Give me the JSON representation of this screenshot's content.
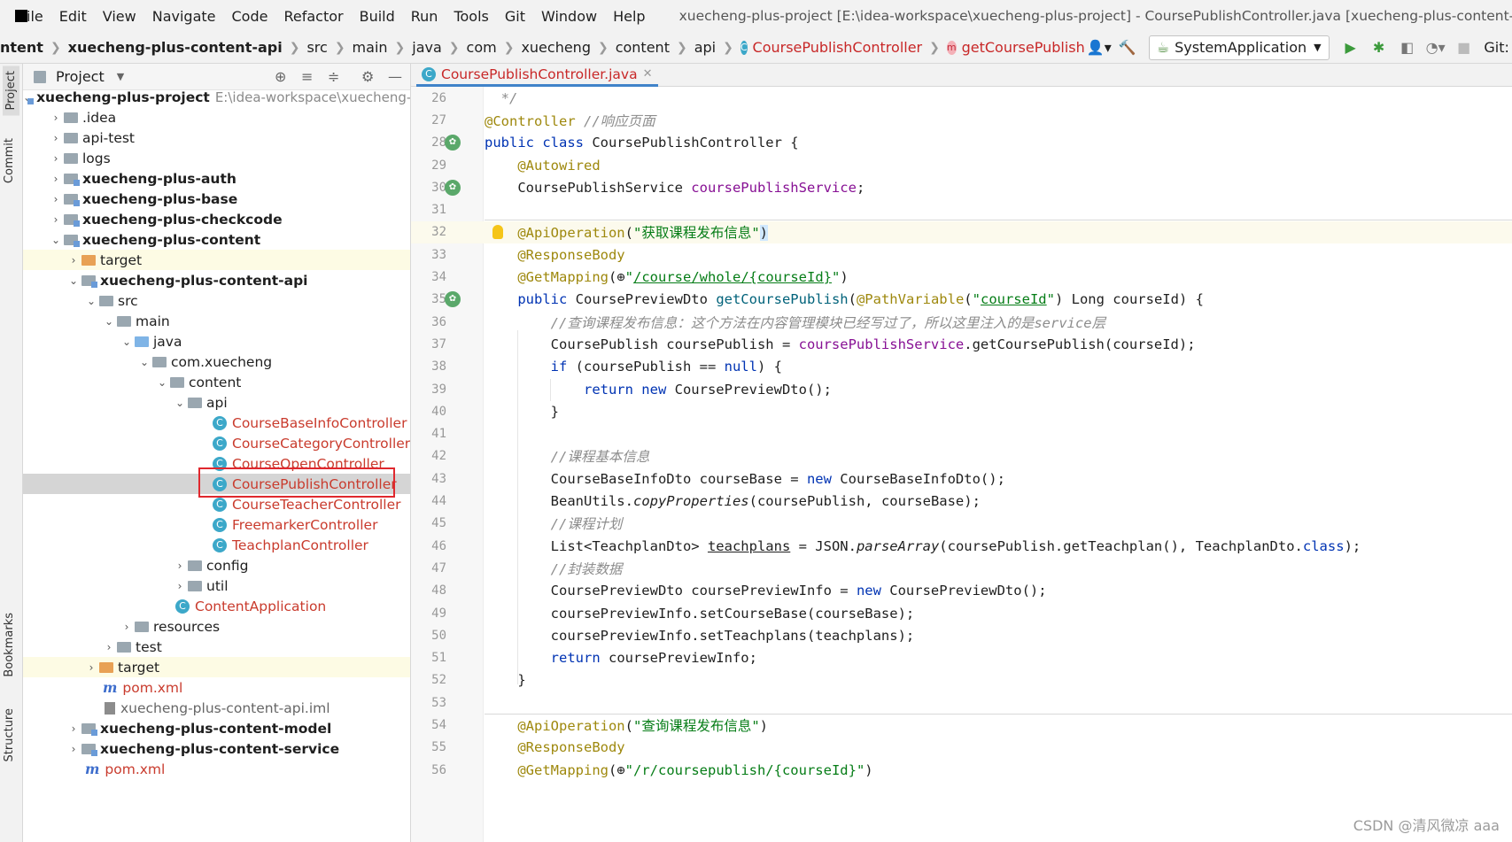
{
  "menubar": {
    "items": [
      "File",
      "Edit",
      "View",
      "Navigate",
      "Code",
      "Refactor",
      "Build",
      "Run",
      "Tools",
      "Git",
      "Window",
      "Help"
    ],
    "window_title": "xuecheng-plus-project [E:\\idea-workspace\\xuecheng-plus-project] - CoursePublishController.java [xuecheng-plus-content-api]"
  },
  "navbar": {
    "crumbs": [
      "ntent",
      "xuecheng-plus-content-api",
      "src",
      "main",
      "java",
      "com",
      "xuecheng",
      "content",
      "api"
    ],
    "class_crumb": "CoursePublishController",
    "method_crumb": "getCoursePublish",
    "run_config": "SystemApplication",
    "git_label": "Git:"
  },
  "side_tabs": {
    "project": "Project",
    "commit": "Commit",
    "bookmarks": "Bookmarks",
    "structure": "Structure"
  },
  "project_panel": {
    "title": "Project",
    "tree": [
      {
        "text": "xuecheng-plus-project",
        "path": "E:\\idea-workspace\\xuecheng-plus-project",
        "bold": true
      },
      {
        "text": ".idea"
      },
      {
        "text": "api-test"
      },
      {
        "text": "logs"
      },
      {
        "text": "xuecheng-plus-auth",
        "bold": true
      },
      {
        "text": "xuecheng-plus-base",
        "bold": true
      },
      {
        "text": "xuecheng-plus-checkcode",
        "bold": true
      },
      {
        "text": "xuecheng-plus-content",
        "bold": true
      },
      {
        "text": "target"
      },
      {
        "text": "xuecheng-plus-content-api",
        "bold": true
      },
      {
        "text": "src"
      },
      {
        "text": "main"
      },
      {
        "text": "java"
      },
      {
        "text": "com.xuecheng"
      },
      {
        "text": "content"
      },
      {
        "text": "api"
      },
      {
        "text": "CourseBaseInfoController"
      },
      {
        "text": "CourseCategoryController"
      },
      {
        "text": "CourseOpenController"
      },
      {
        "text": "CoursePublishController"
      },
      {
        "text": "CourseTeacherController"
      },
      {
        "text": "FreemarkerController"
      },
      {
        "text": "TeachplanController"
      },
      {
        "text": "config"
      },
      {
        "text": "util"
      },
      {
        "text": "ContentApplication"
      },
      {
        "text": "resources"
      },
      {
        "text": "test"
      },
      {
        "text": "target"
      },
      {
        "text": "pom.xml"
      },
      {
        "text": "xuecheng-plus-content-api.iml"
      },
      {
        "text": "xuecheng-plus-content-model",
        "bold": true
      },
      {
        "text": "xuecheng-plus-content-service",
        "bold": true
      },
      {
        "text": "pom.xml"
      }
    ]
  },
  "editor": {
    "tab_label": "CoursePublishController.java",
    "lines": [
      {
        "n": "26",
        "t": "  */"
      },
      {
        "n": "27",
        "t": "@Controller //响应页面"
      },
      {
        "n": "28",
        "t": "public class CoursePublishController {"
      },
      {
        "n": "29",
        "t": "    @Autowired"
      },
      {
        "n": "30",
        "t": "    CoursePublishService coursePublishService;"
      },
      {
        "n": "31",
        "t": ""
      },
      {
        "n": "32",
        "t": "    @ApiOperation(\"获取课程发布信息\")"
      },
      {
        "n": "33",
        "t": "    @ResponseBody"
      },
      {
        "n": "34",
        "t": "    @GetMapping(\"/course/whole/{courseId}\")"
      },
      {
        "n": "35",
        "t": "    public CoursePreviewDto getCoursePublish(@PathVariable(\"courseId\") Long courseId) {"
      },
      {
        "n": "36",
        "t": "        //查询课程发布信息：这个方法在内容管理模块已经写过了，所以这里注入的是service层"
      },
      {
        "n": "37",
        "t": "        CoursePublish coursePublish = coursePublishService.getCoursePublish(courseId);"
      },
      {
        "n": "38",
        "t": "        if (coursePublish == null) {"
      },
      {
        "n": "39",
        "t": "            return new CoursePreviewDto();"
      },
      {
        "n": "40",
        "t": "        }"
      },
      {
        "n": "41",
        "t": ""
      },
      {
        "n": "42",
        "t": "        //课程基本信息"
      },
      {
        "n": "43",
        "t": "        CourseBaseInfoDto courseBase = new CourseBaseInfoDto();"
      },
      {
        "n": "44",
        "t": "        BeanUtils.copyProperties(coursePublish, courseBase);"
      },
      {
        "n": "45",
        "t": "        //课程计划"
      },
      {
        "n": "46",
        "t": "        List<TeachplanDto> teachplans = JSON.parseArray(coursePublish.getTeachplan(), TeachplanDto.class);"
      },
      {
        "n": "47",
        "t": "        //封装数据"
      },
      {
        "n": "48",
        "t": "        CoursePreviewDto coursePreviewInfo = new CoursePreviewDto();"
      },
      {
        "n": "49",
        "t": "        coursePreviewInfo.setCourseBase(courseBase);"
      },
      {
        "n": "50",
        "t": "        coursePreviewInfo.setTeachplans(teachplans);"
      },
      {
        "n": "51",
        "t": "        return coursePreviewInfo;"
      },
      {
        "n": "52",
        "t": "    }"
      },
      {
        "n": "53",
        "t": ""
      },
      {
        "n": "54",
        "t": "    @ApiOperation(\"查询课程发布信息\")"
      },
      {
        "n": "55",
        "t": "    @ResponseBody"
      },
      {
        "n": "56",
        "t": "    @GetMapping(\"/r/coursepublish/{courseId}\")"
      }
    ]
  },
  "watermark": "CSDN @清风微凉 aaa",
  "colors": {
    "accent": "#4083c9",
    "selection_box": "#e0282e",
    "keyword": "#0033b3",
    "annotation": "#9e880d",
    "string": "#067d17",
    "comment": "#8c8c8c",
    "field": "#871094"
  }
}
